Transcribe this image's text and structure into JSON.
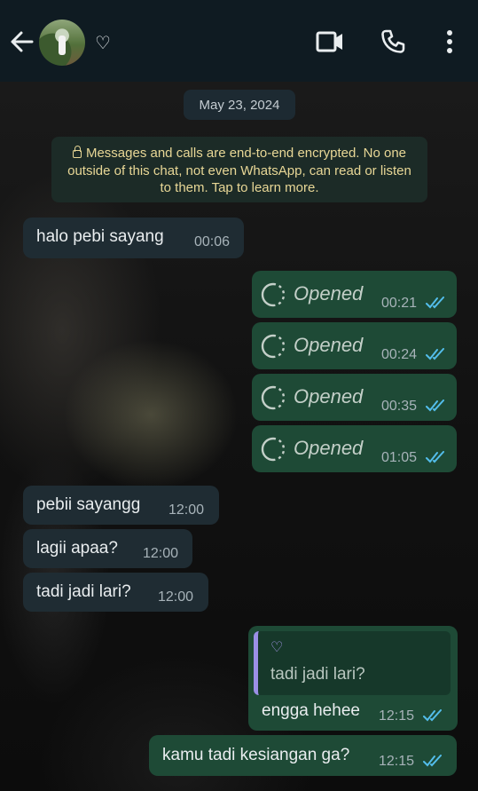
{
  "header": {
    "contact_name": "♡",
    "back_icon": "arrow-left-icon",
    "video_icon": "video-call-icon",
    "call_icon": "phone-icon",
    "menu_icon": "more-vert-icon"
  },
  "chat": {
    "date": "May 23, 2024",
    "encryption_notice": "Messages and calls are end-to-end encrypted. No one outside of this chat, not even WhatsApp, can read or listen to them. Tap to learn more.",
    "messages": [
      {
        "dir": "in",
        "text": "halo pebi sayang",
        "time": "00:06"
      },
      {
        "dir": "out",
        "text": "Opened",
        "time": "00:21",
        "type": "view-once"
      },
      {
        "dir": "out",
        "text": "Opened",
        "time": "00:24",
        "type": "view-once"
      },
      {
        "dir": "out",
        "text": "Opened",
        "time": "00:35",
        "type": "view-once"
      },
      {
        "dir": "out",
        "text": "Opened",
        "time": "01:05",
        "type": "view-once"
      },
      {
        "dir": "in",
        "text": "pebii sayangg",
        "time": "12:00"
      },
      {
        "dir": "in",
        "text": "lagii apaa?",
        "time": "12:00"
      },
      {
        "dir": "in",
        "text": "tadi jadi lari?",
        "time": "12:00"
      },
      {
        "dir": "out",
        "text": "engga hehee",
        "time": "12:15",
        "quote": {
          "author": "♡",
          "text": "tadi jadi lari?"
        }
      },
      {
        "dir": "out",
        "text": "kamu tadi kesiangan ga?",
        "time": "12:15"
      }
    ]
  },
  "colors": {
    "header_bg": "#0f1b22",
    "incoming_bubble": "#1f2c33",
    "outgoing_bubble": "#1e4a36",
    "read_ticks": "#53bdeb",
    "encryption_text": "#e8d796"
  }
}
